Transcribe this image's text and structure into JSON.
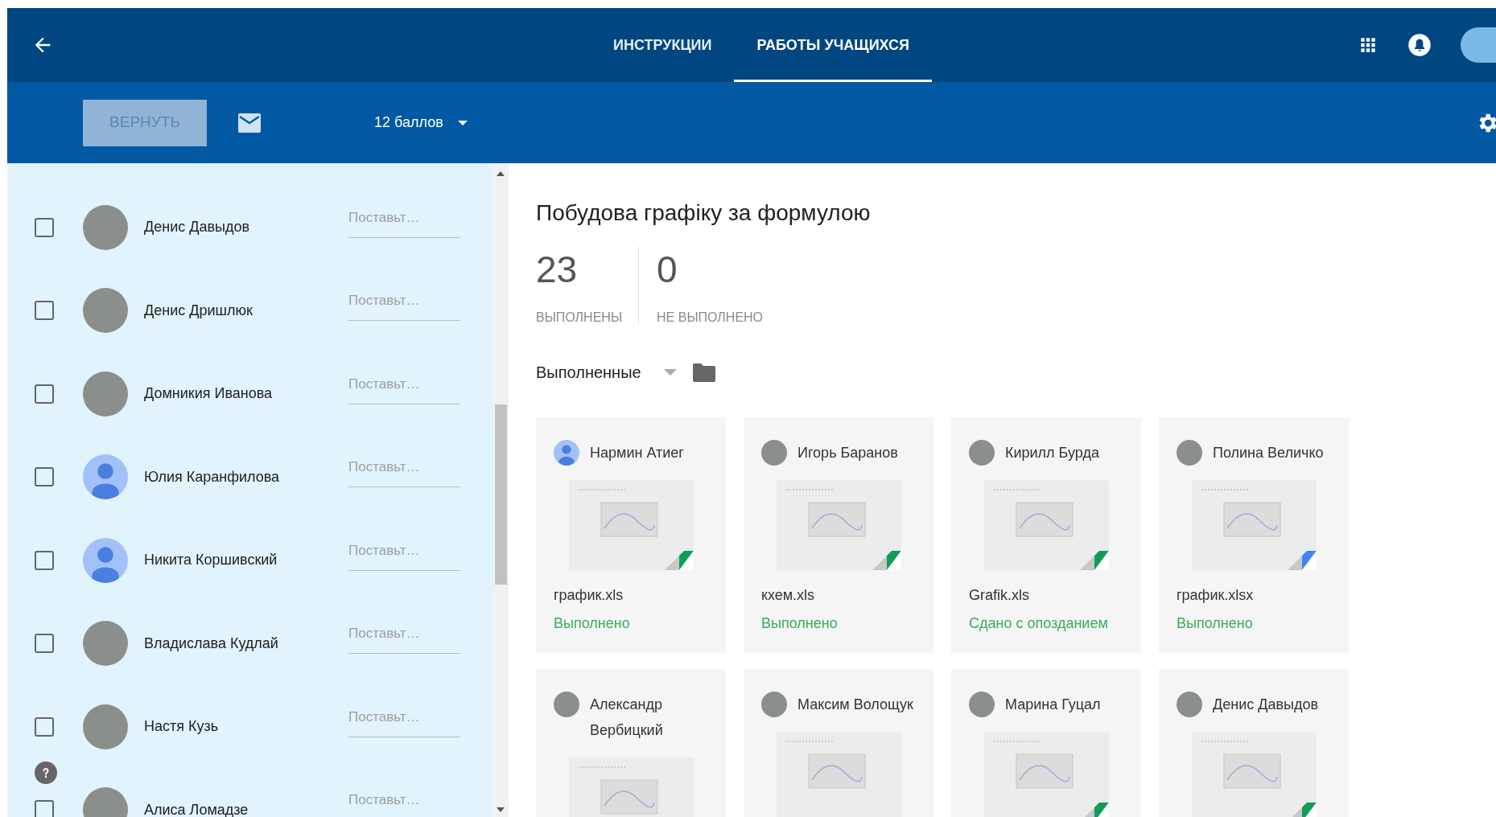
{
  "header": {
    "tabs": [
      {
        "label": "ИНСТРУКЦИИ",
        "selected": false
      },
      {
        "label": "РАБОТЫ УЧАЩИХСЯ",
        "selected": true
      }
    ]
  },
  "toolbar": {
    "return_button": {
      "label": "ВЕРНУТЬ",
      "disabled": true
    },
    "points": "12 баллов"
  },
  "students": [
    {
      "name": "Денис Давыдов",
      "avatar": {
        "kind": "photo"
      },
      "checked": false,
      "grade_placeholder": "Поставьт…"
    },
    {
      "name": "Денис Дришлюк",
      "avatar": {
        "kind": "photo"
      },
      "checked": false,
      "grade_placeholder": "Поставьт…"
    },
    {
      "name": "Домникия Иванова",
      "avatar": {
        "kind": "photo"
      },
      "checked": false,
      "grade_placeholder": "Поставьт…"
    },
    {
      "name": "Юлия Каранфилова",
      "avatar": {
        "kind": "default"
      },
      "checked": false,
      "grade_placeholder": "Поставьт…"
    },
    {
      "name": "Никита Коршивский",
      "avatar": {
        "kind": "default"
      },
      "checked": false,
      "grade_placeholder": "Поставьт…"
    },
    {
      "name": "Владислава Кудлай",
      "avatar": {
        "kind": "photo"
      },
      "checked": false,
      "grade_placeholder": "Поставьт…"
    },
    {
      "name": "Настя Кузь",
      "avatar": {
        "kind": "photo"
      },
      "checked": false,
      "grade_placeholder": "Поставьт…"
    },
    {
      "name": "Алиса Ломадзе",
      "avatar": {
        "kind": "photo"
      },
      "checked": false,
      "grade_placeholder": "Поставьт…"
    }
  ],
  "assignment": {
    "title": "Побудова графіку за формулою",
    "stats": [
      {
        "value": "23",
        "label": "ВЫПОЛНЕНЫ"
      },
      {
        "value": "0",
        "label": "НЕ ВЫПОЛНЕНО"
      }
    ],
    "filter": "Выполненные",
    "submissions": [
      {
        "name": "Нармин Атиег",
        "avatar": {
          "kind": "default"
        },
        "file": "график.xls",
        "status": "Выполнено",
        "color": "#0f9d58"
      },
      {
        "name": "Игорь Баранов",
        "avatar": {
          "kind": "photo"
        },
        "file": "кхем.xls",
        "status": "Выполнено",
        "color": "#0f9d58"
      },
      {
        "name": "Кирилл Бурда",
        "avatar": {
          "kind": "photo"
        },
        "file": "Grafik.xls",
        "status": "Сдано с опозданием",
        "color": "#0f9d58"
      },
      {
        "name": "Полина Величко",
        "avatar": {
          "kind": "photo"
        },
        "file": "график.xlsx",
        "status": "Выполнено",
        "color": "#4285f4"
      },
      {
        "name": "Александр Вербицкий",
        "avatar": {
          "kind": "photo"
        }
      },
      {
        "name": "Максим Волощук",
        "avatar": {
          "kind": "photo"
        }
      },
      {
        "name": "Марина Гуцал",
        "avatar": {
          "kind": "photo"
        },
        "color": "#0f9d58"
      },
      {
        "name": "Денис Давыдов",
        "avatar": {
          "kind": "photo"
        },
        "color": "#0f9d58"
      }
    ]
  }
}
